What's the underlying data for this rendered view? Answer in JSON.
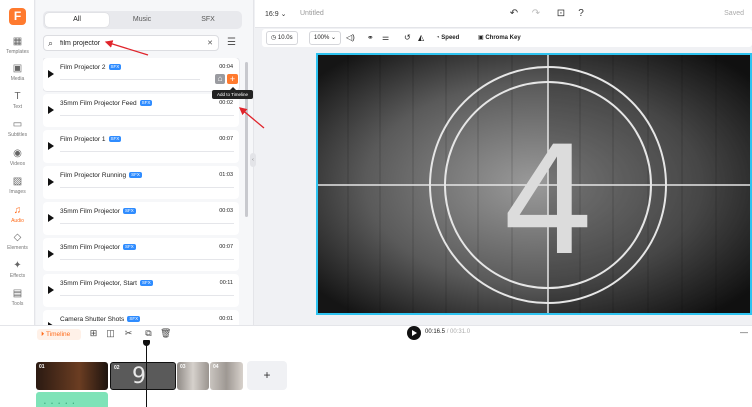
{
  "rail": {
    "items": [
      {
        "label": "Templates",
        "icon": "templates-icon"
      },
      {
        "label": "Media",
        "icon": "media-icon"
      },
      {
        "label": "Text",
        "icon": "text-icon"
      },
      {
        "label": "Subtitles",
        "icon": "subtitles-icon"
      },
      {
        "label": "Videos",
        "icon": "videos-icon"
      },
      {
        "label": "Images",
        "icon": "images-icon"
      },
      {
        "label": "Audio",
        "icon": "audio-icon",
        "active": true
      },
      {
        "label": "Elements",
        "icon": "elements-icon"
      },
      {
        "label": "Effects",
        "icon": "effects-icon"
      },
      {
        "label": "Tools",
        "icon": "tools-icon"
      }
    ]
  },
  "panel": {
    "tabs": [
      "All",
      "Music",
      "SFX"
    ],
    "active_tab": "All",
    "search": {
      "value": "film projector",
      "placeholder": "Search"
    },
    "sfx_badge": "SFX",
    "results": [
      {
        "title": "Film Projector 2",
        "duration": "00:04"
      },
      {
        "title": "35mm Film Projector Feed",
        "duration": "00:02"
      },
      {
        "title": "Film Projector 1",
        "duration": "00:07"
      },
      {
        "title": "Film Projector Running",
        "duration": "01:03"
      },
      {
        "title": "35mm Film Projector",
        "duration": "00:03"
      },
      {
        "title": "35mm Film Projector",
        "duration": "00:07"
      },
      {
        "title": "35mm Film Projector, Start",
        "duration": "00:11"
      },
      {
        "title": "Camera Shutter Shots",
        "duration": "00:01"
      }
    ],
    "tooltip": "Add to Timeline"
  },
  "topbar": {
    "ratio": "16:9",
    "project_name": "Untitled",
    "status": "Saved"
  },
  "toolbar": {
    "duration": "10.0s",
    "zoom": "100%",
    "speed": "Speed",
    "chroma": "Chroma Key"
  },
  "preview": {
    "countdown_number": "4"
  },
  "timeline": {
    "label": "Timeline",
    "current_time": "00:16.5",
    "total_time": "00:31.0",
    "clips": [
      {
        "num": "01"
      },
      {
        "num": "02",
        "frame_number": "9"
      },
      {
        "num": "03"
      },
      {
        "num": "04"
      }
    ],
    "add_label": "+"
  },
  "colors": {
    "accent": "#ff7a2e",
    "selection": "#2ec3f0",
    "sfx_badge": "#2f8cff",
    "audio_track": "#7ee3b8",
    "annotation_arrow": "#e0242b"
  }
}
